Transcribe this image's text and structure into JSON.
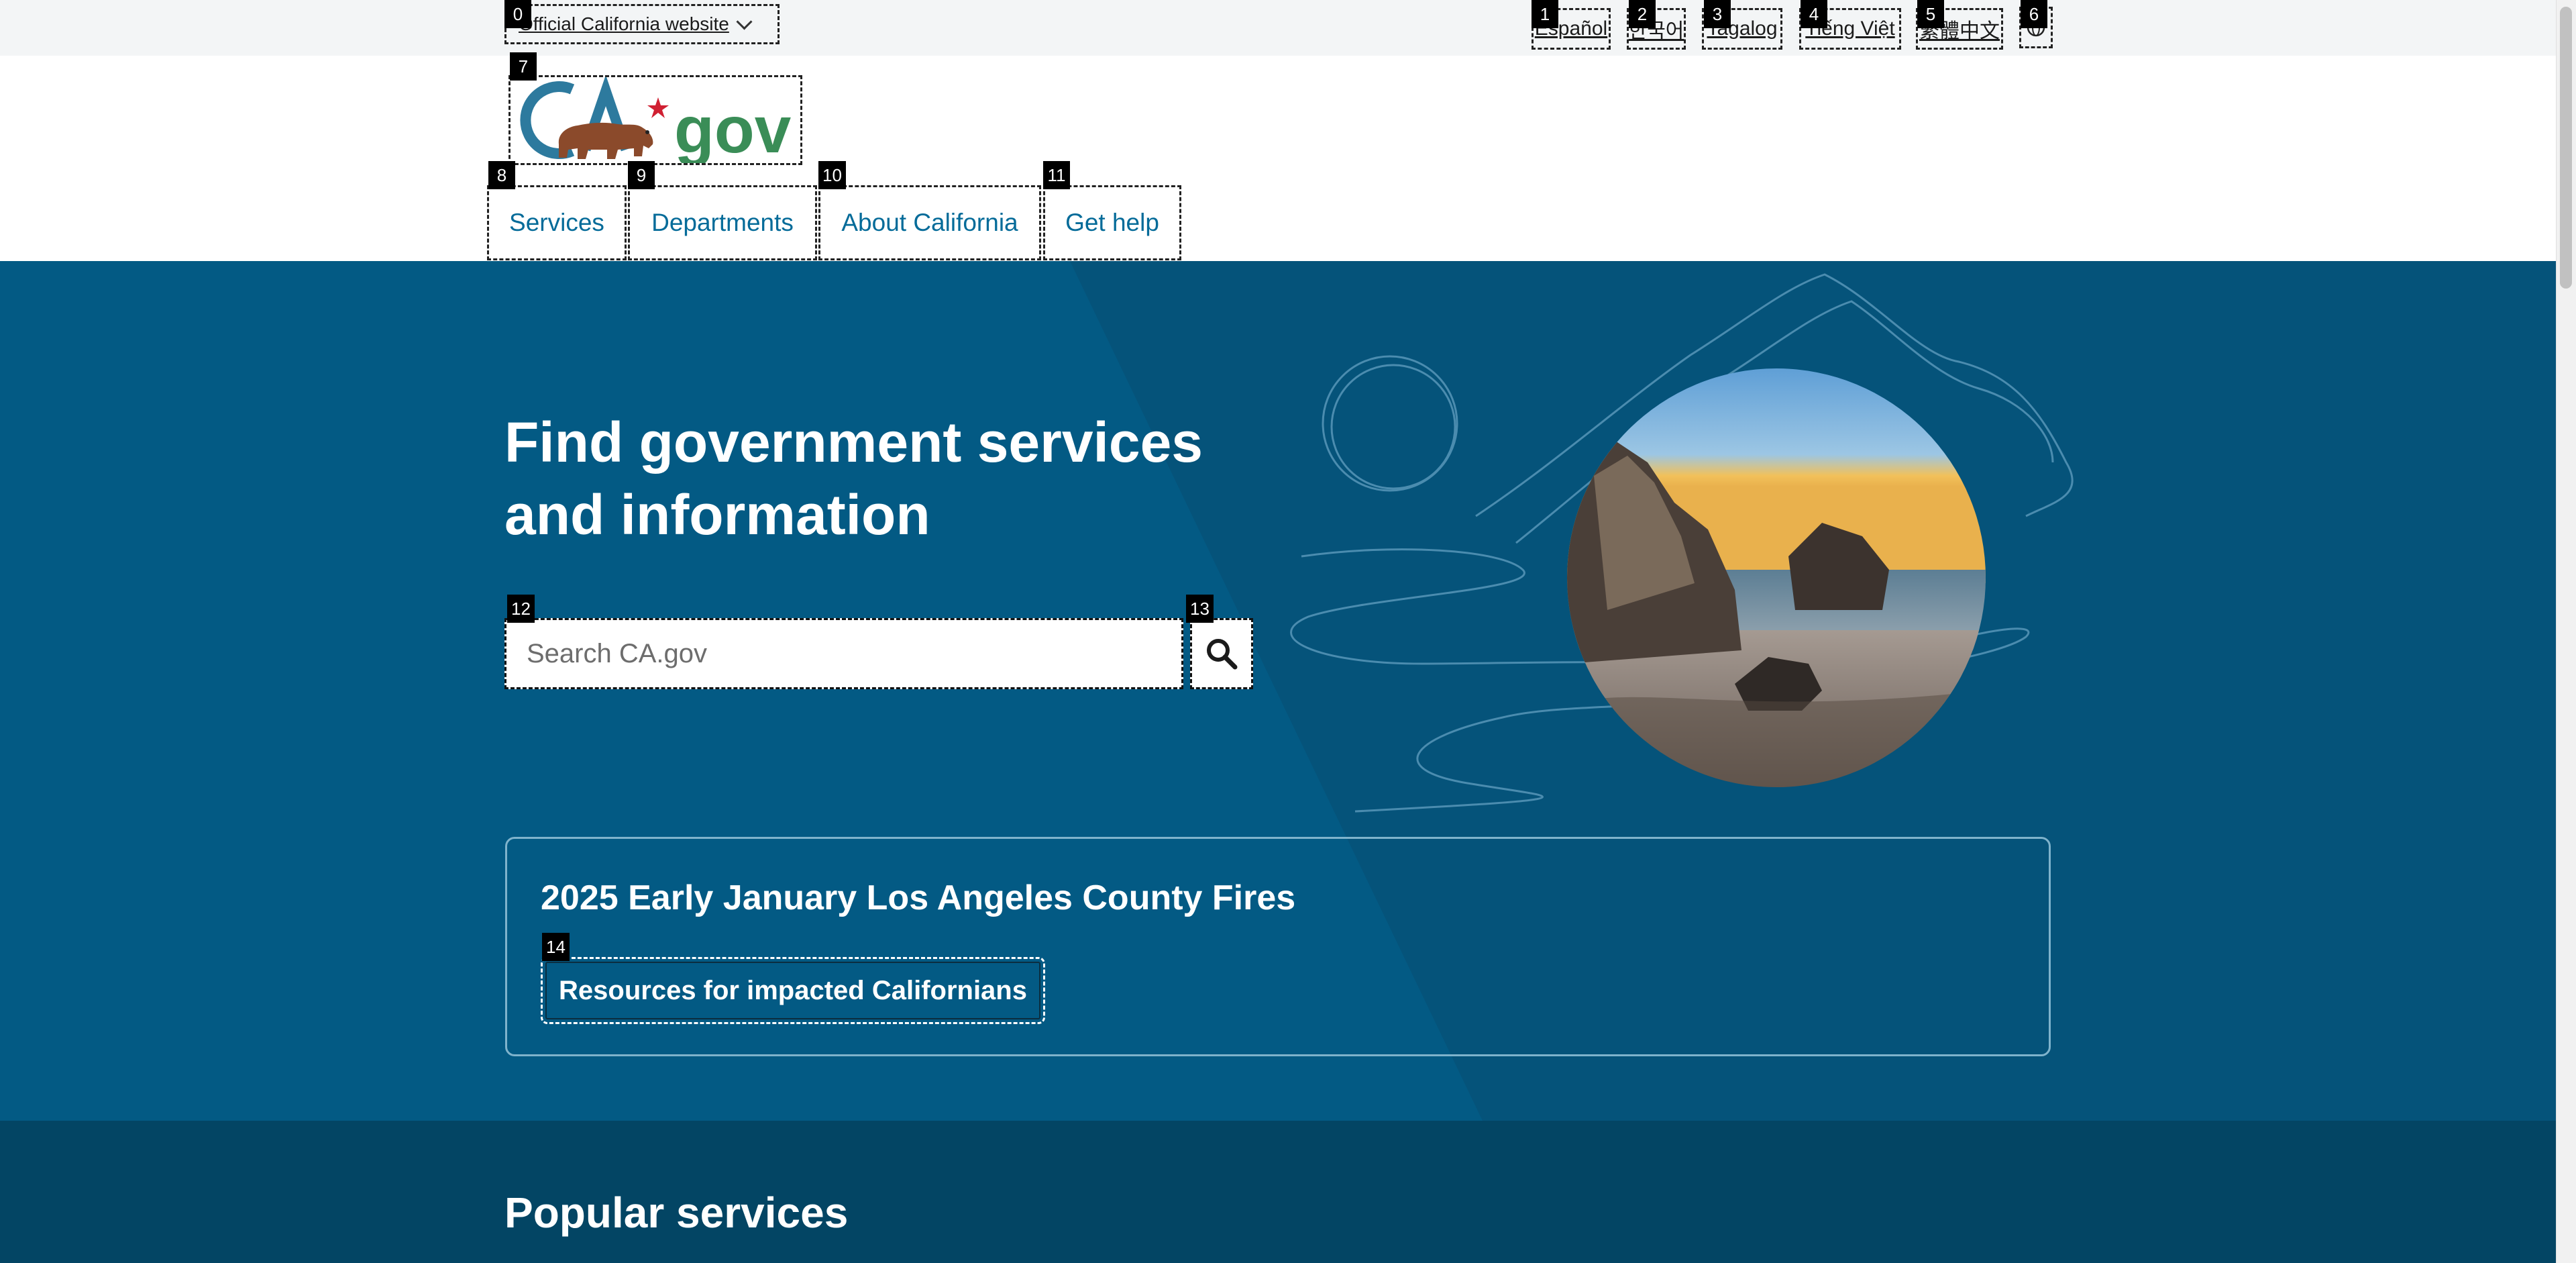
{
  "utility": {
    "official_label": "Official California website",
    "languages": [
      "Español",
      "한국어",
      "Tagalog",
      "Tiếng Việt",
      "繁體中文"
    ]
  },
  "logo": {
    "alt": "CA.gov"
  },
  "nav": {
    "items": [
      "Services",
      "Departments",
      "About California",
      "Get help"
    ]
  },
  "hero": {
    "title_line1": "Find government services",
    "title_line2": "and information",
    "search_placeholder": "Search CA.gov"
  },
  "alert": {
    "title": "2025 Early January Los Angeles County Fires",
    "button_label": "Resources for impacted Californians"
  },
  "popular": {
    "title": "Popular services"
  },
  "annotation_tags": [
    "0",
    "1",
    "2",
    "3",
    "4",
    "5",
    "6",
    "7",
    "8",
    "9",
    "10",
    "11",
    "12",
    "13",
    "14"
  ],
  "colors": {
    "nav_link": "#046b99",
    "hero_bg": "#035a84",
    "popular_bg": "#034564",
    "utility_bg": "#f3f5f6"
  },
  "icons": [
    "chevron-down-icon",
    "globe-icon",
    "search-icon",
    "ca-gov-logo"
  ]
}
